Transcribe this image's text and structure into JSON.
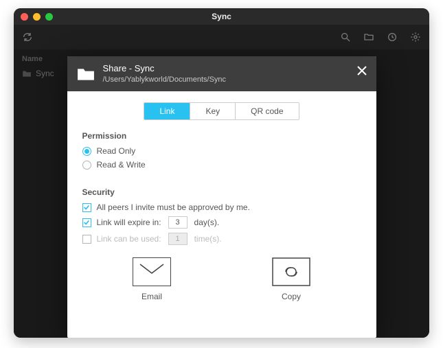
{
  "window": {
    "title": "Sync"
  },
  "columns": {
    "name": "Name"
  },
  "files": {
    "item0": {
      "name": "Sync"
    }
  },
  "modal": {
    "title": "Share - Sync",
    "path": "/Users/Yablykworld/Documents/Sync",
    "tabs": {
      "link": "Link",
      "key": "Key",
      "qr": "QR code"
    },
    "permission": {
      "heading": "Permission",
      "readonly": "Read Only",
      "readwrite": "Read & Write"
    },
    "security": {
      "heading": "Security",
      "approve": "All peers I invite must be approved by me.",
      "expire_prefix": "Link will expire in:",
      "expire_value": "3",
      "expire_suffix": "day(s).",
      "uses_prefix": "Link can be used:",
      "uses_value": "1",
      "uses_suffix": "time(s)."
    },
    "actions": {
      "email": "Email",
      "copy": "Copy"
    }
  }
}
